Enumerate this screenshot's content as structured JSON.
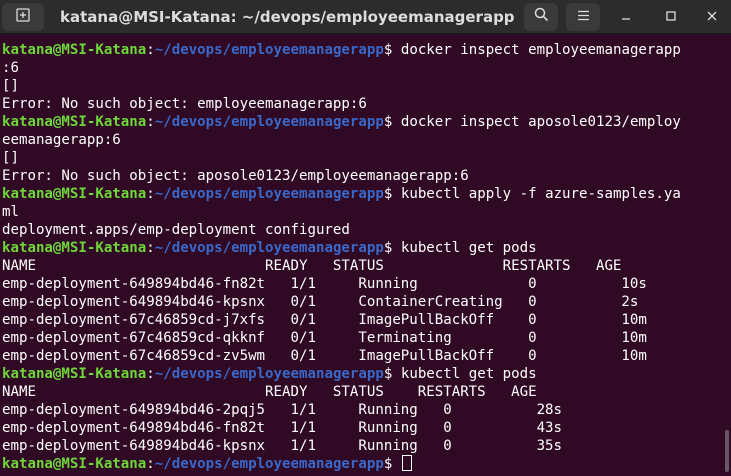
{
  "window": {
    "title": "katana@MSI-Katana: ~/devops/employeemanagerapp"
  },
  "icons": {
    "new_tab": "new-tab-icon",
    "search": "search-icon",
    "menu": "hamburger-menu-icon",
    "minimize": "minimize-icon",
    "maximize": "maximize-icon",
    "close": "close-icon"
  },
  "colors": {
    "background": "#300a24",
    "prompt_user": "#6fd63a",
    "prompt_path": "#3a68c9",
    "text": "#ffffff"
  },
  "prompt": {
    "user": "katana@MSI-Katana",
    "colon": ":",
    "path": "~/devops/employeemanagerapp",
    "dollar": "$ "
  },
  "lines": [
    {
      "type": "prompt",
      "cmd": "docker inspect employeemanagerapp"
    },
    {
      "type": "text",
      "text": ":6"
    },
    {
      "type": "text",
      "text": "[]"
    },
    {
      "type": "text",
      "text": "Error: No such object: employeemanagerapp:6"
    },
    {
      "type": "prompt",
      "cmd": "docker inspect aposole0123/employ"
    },
    {
      "type": "text",
      "text": "eemanagerapp:6"
    },
    {
      "type": "text",
      "text": "[]"
    },
    {
      "type": "text",
      "text": "Error: No such object: aposole0123/employeemanagerapp:6"
    },
    {
      "type": "prompt",
      "cmd": "kubectl apply -f azure-samples.ya"
    },
    {
      "type": "text",
      "text": "ml"
    },
    {
      "type": "text",
      "text": "deployment.apps/emp-deployment configured"
    },
    {
      "type": "prompt",
      "cmd": "kubectl get pods"
    },
    {
      "type": "text",
      "text": "NAME                           READY   STATUS              RESTARTS   AGE"
    },
    {
      "type": "text",
      "text": "emp-deployment-649894bd46-fn82t   1/1     Running             0          10s"
    },
    {
      "type": "text",
      "text": "emp-deployment-649894bd46-kpsnx   0/1     ContainerCreating   0          2s"
    },
    {
      "type": "text",
      "text": "emp-deployment-67c46859cd-j7xfs   0/1     ImagePullBackOff    0          10m"
    },
    {
      "type": "text",
      "text": "emp-deployment-67c46859cd-qkknf   0/1     Terminating         0          10m"
    },
    {
      "type": "text",
      "text": "emp-deployment-67c46859cd-zv5wm   0/1     ImagePullBackOff    0          10m"
    },
    {
      "type": "prompt",
      "cmd": "kubectl get pods"
    },
    {
      "type": "text",
      "text": "NAME                           READY   STATUS    RESTARTS   AGE"
    },
    {
      "type": "text",
      "text": "emp-deployment-649894bd46-2pqj5   1/1     Running   0          28s"
    },
    {
      "type": "text",
      "text": "emp-deployment-649894bd46-fn82t   1/1     Running   0          43s"
    },
    {
      "type": "text",
      "text": "emp-deployment-649894bd46-kpsnx   1/1     Running   0          35s"
    },
    {
      "type": "prompt",
      "cmd": "",
      "cursor": true
    }
  ]
}
